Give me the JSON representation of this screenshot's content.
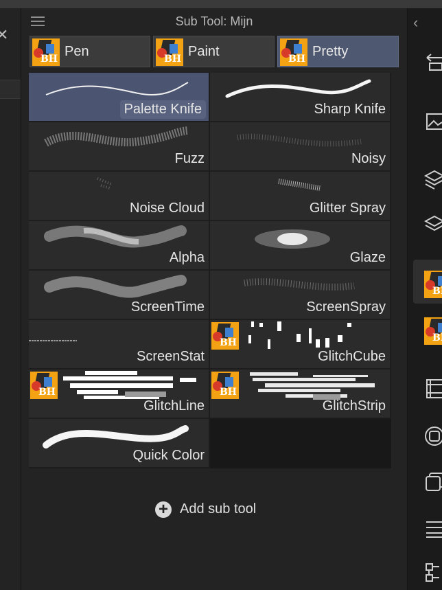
{
  "header": {
    "title": "Sub Tool: Mijn",
    "menu_icon": "hamburger-menu-icon"
  },
  "tabs": [
    {
      "label": "Pen",
      "active": false
    },
    {
      "label": "Paint",
      "active": false
    },
    {
      "label": "Pretty",
      "active": true
    }
  ],
  "brushes": [
    {
      "label": "Palette Knife",
      "selected": true
    },
    {
      "label": "Sharp Knife"
    },
    {
      "label": "Fuzz"
    },
    {
      "label": "Noisy"
    },
    {
      "label": "Noise Cloud"
    },
    {
      "label": "Glitter Spray"
    },
    {
      "label": "Alpha"
    },
    {
      "label": "Glaze"
    },
    {
      "label": "ScreenTime"
    },
    {
      "label": "ScreenSpray"
    },
    {
      "label": "ScreenStat"
    },
    {
      "label": "GlitchCube"
    },
    {
      "label": "GlitchLine"
    },
    {
      "label": "GlitchStrip"
    },
    {
      "label": "Quick Color"
    }
  ],
  "add_sub_tool": {
    "label": "Add sub tool",
    "icon": "plus-circle-icon"
  },
  "brand_icon": {
    "text": "BH"
  },
  "right_toolbar": {
    "icons": [
      "collapse-chevron-icon",
      "navigator-icon",
      "image-icon",
      "layer-property-icon",
      "layers-icon",
      "sub-tool-icon",
      "brush-preset-icon",
      "animation-timeline-icon",
      "color-circle-icon",
      "color-set-icon",
      "layer-search-icon",
      "node-icon"
    ]
  },
  "colors": {
    "accent": "#4e5870",
    "selected_tile": "#4b5571",
    "panel": "#232323",
    "tile": "#2b2b2b",
    "brand_orange": "#f2a213"
  }
}
